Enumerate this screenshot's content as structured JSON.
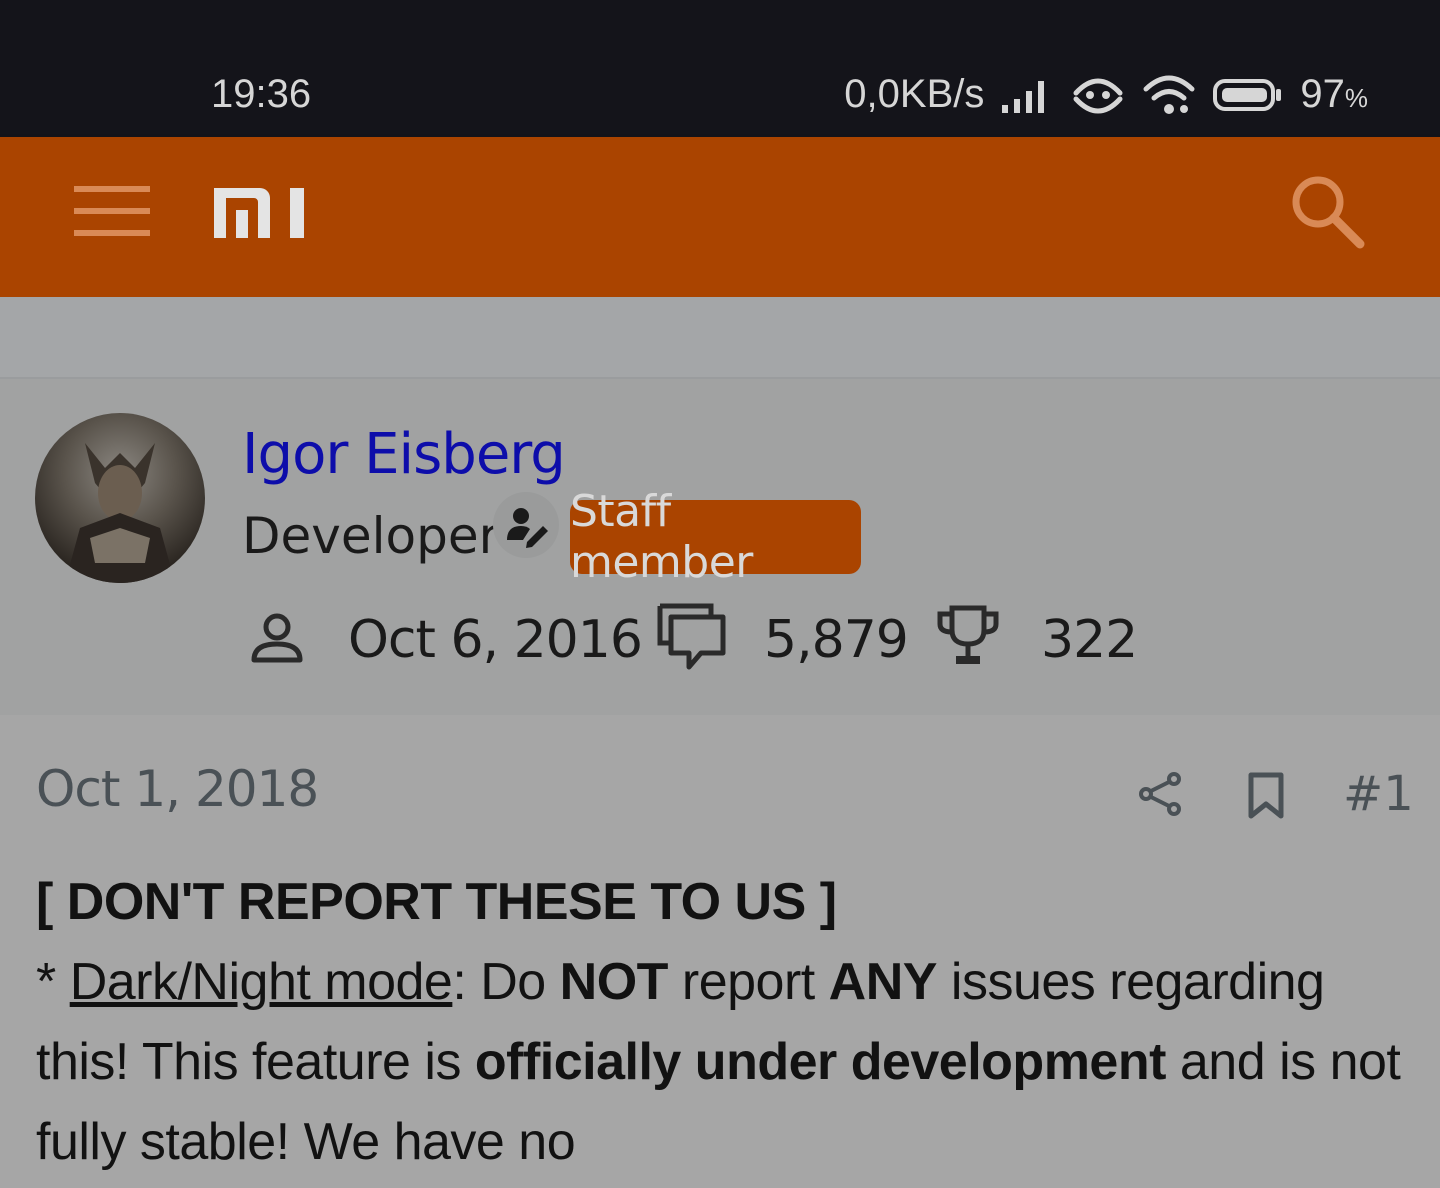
{
  "status_bar": {
    "time": "19:36",
    "network_speed": "0,0KB/s",
    "battery": "97",
    "battery_unit": "%",
    "icons": [
      "signal-icon",
      "hotspot-icon",
      "wifi-icon",
      "battery-icon"
    ]
  },
  "app_bar": {
    "color": "#aa4400",
    "icons": [
      "menu-icon",
      "mi-logo",
      "search-icon"
    ]
  },
  "user": {
    "name": "Igor Eisberg",
    "title": "Developer",
    "badge": "Staff member",
    "joined": "Oct 6, 2016",
    "messages": "5,879",
    "reactions": "322",
    "name_color": "#0d0daa"
  },
  "post": {
    "date": "Oct 1, 2018",
    "number": "#1",
    "heading": "[ DON'T REPORT THESE TO US ]",
    "p_bullet": "* ",
    "p_link": "Dark/Night mode",
    "p_t1": ": Do ",
    "p_b1": "NOT",
    "p_t2": " report ",
    "p_b2": "ANY",
    "p_t3": " issues regarding this! This feature is ",
    "p_b3": "officially under development",
    "p_t4": " and is not fully stable! We have no"
  }
}
